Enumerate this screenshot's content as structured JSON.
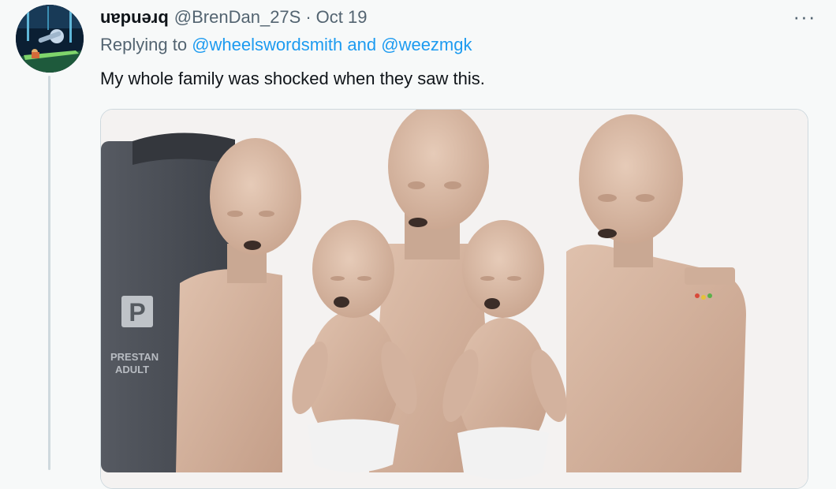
{
  "tweet": {
    "display_name": "uɐpuǝɹq",
    "handle": "@BrenDan_27S",
    "separator": "·",
    "date": "Oct 19",
    "more_icon": "more-icon",
    "more_glyph": "···",
    "reply_prefix": "Replying to",
    "reply_user_1": "@wheelswordsmith",
    "reply_and": "and",
    "reply_user_2": "@weezmgk",
    "text": "My whole family was shocked when they saw this."
  },
  "media": {
    "bag_brand_line1": "PRESTAN",
    "bag_brand_line2": "ADULT",
    "bag_logo_letter": "P"
  },
  "colors": {
    "link": "#1d9bf0",
    "secondary_text": "#536471",
    "background": "#f7f9f9",
    "skin": "#d8b9a6"
  }
}
